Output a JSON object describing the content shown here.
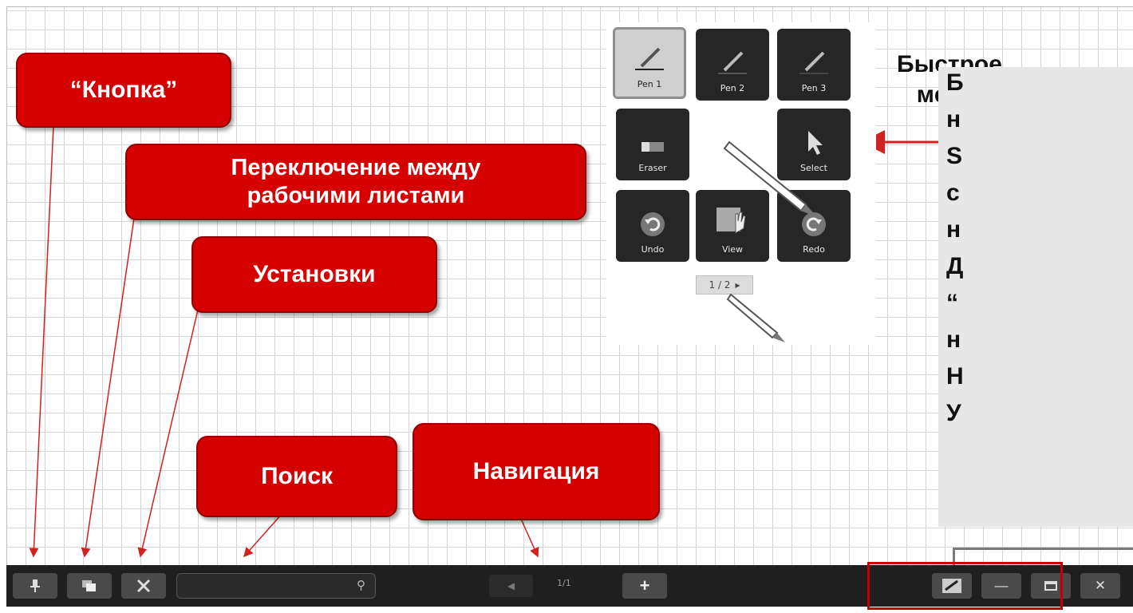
{
  "callouts": {
    "button": "“Кнопка”",
    "switch_line1": "Переключение между",
    "switch_line2": "рабочими листами",
    "settings": "Установки",
    "search": "Поиск",
    "navigation": "Навигация"
  },
  "quick_menu": {
    "title_line1": "Быстрое",
    "title_line2": "меню",
    "buttons": {
      "pen1": "Pen 1",
      "pen2": "Pen 2",
      "pen3": "Pen 3",
      "eraser": "Eraser",
      "select": "Select",
      "undo": "Undo",
      "view": "View",
      "redo": "Redo"
    },
    "pager": "1 / 2",
    "pager_arrow": "▸"
  },
  "side_text_lines": [
    "Б",
    "н",
    "S",
    "с",
    "н",
    "Д",
    "“",
    "н",
    "Н",
    "У"
  ],
  "toolbar": {
    "pin_icon": "pin-icon",
    "sheets_icon": "sheets-icon",
    "settings_icon": "tools-icon",
    "search_icon": "⚲",
    "page_indicator": "1/1",
    "add_label": "+",
    "prev_label": "◀",
    "minimize_label": "—",
    "close_label": "✕"
  },
  "colors": {
    "callout_red": "#d50000",
    "arrow_red": "#d32020",
    "toolbar_bg": "#1f1f1f"
  }
}
